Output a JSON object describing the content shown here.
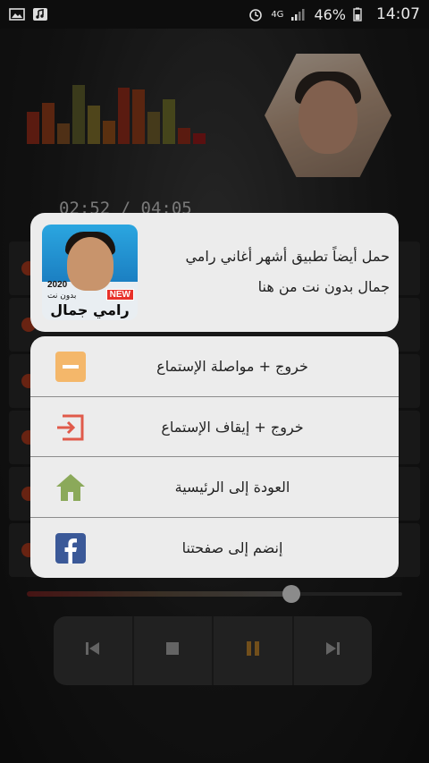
{
  "status_bar": {
    "network": "4G",
    "battery": "46%",
    "time": "14:07"
  },
  "player": {
    "time_readout": "02:52 / 04:05",
    "seek_progress": 0.71,
    "equalizer_levels": [
      0.55,
      0.7,
      0.35,
      1.0,
      0.65,
      0.4,
      0.95,
      0.92,
      0.55,
      0.75,
      0.28,
      0.18
    ],
    "equalizer_colors": [
      "#8a2a1a",
      "#8a3a1a",
      "#7a4a22",
      "#5a5a2a",
      "#7a6a2a",
      "#8a4a1a",
      "#8a2a1a",
      "#8a3a1a",
      "#6a5a2a",
      "#6a6a2a",
      "#8a2a1a",
      "#8a1a1a"
    ],
    "controls": {
      "previous": "previous-icon",
      "stop": "stop-icon",
      "pause": "pause-icon",
      "next": "next-icon"
    }
  },
  "promo": {
    "text": "حمل أيضاً تطبيق أشهر أغاني رامي جمال بدون نت من هنا",
    "thumbnail": {
      "name": "رامي جمال",
      "year": "2020",
      "subtitle": "بدون نت",
      "badge": "NEW"
    }
  },
  "menu": [
    {
      "label": "خروج + مواصلة الإستماع",
      "icon": "minus-icon",
      "color": "#f4b76a"
    },
    {
      "label": "خروج + إيقاف الإستماع",
      "icon": "exit-icon",
      "color": "#e05a4a"
    },
    {
      "label": "العودة إلى الرئيسية",
      "icon": "home-icon",
      "color": "#8ba95a"
    },
    {
      "label": "إنضم إلى صفحتنا",
      "icon": "facebook-icon",
      "color": "#3b5998"
    }
  ]
}
